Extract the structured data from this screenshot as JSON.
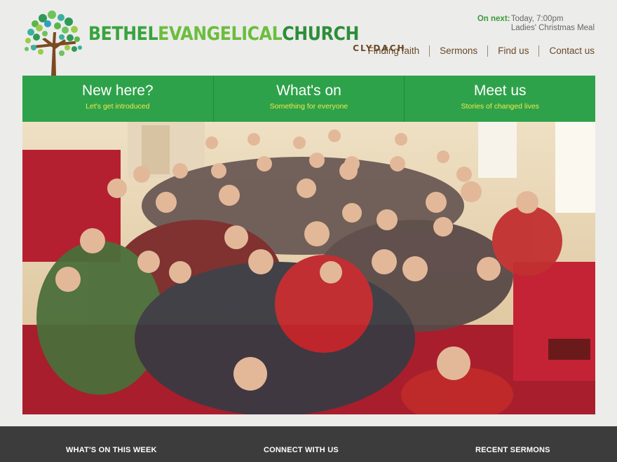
{
  "brand": {
    "name_part1": "BETHEL",
    "name_part2": "EVANGELICAL",
    "name_part3": "CHURCH",
    "location": "CLYDACH"
  },
  "on_next": {
    "label": "On next:",
    "line1": "Today, 7:00pm",
    "line2": "Ladies' Christmas Meal"
  },
  "nav": {
    "items": [
      {
        "label": "Finding faith"
      },
      {
        "label": "Sermons"
      },
      {
        "label": "Find us"
      },
      {
        "label": "Contact us"
      }
    ]
  },
  "promo": [
    {
      "title": "New here?",
      "subtitle": "Let's get introduced"
    },
    {
      "title": "What's on",
      "subtitle": "Something for everyone"
    },
    {
      "title": "Meet us",
      "subtitle": "Stories of changed lives"
    }
  ],
  "footer": {
    "col1": "WHAT'S ON THIS WEEK",
    "col2": "CONNECT WITH US",
    "col3": "RECENT SERMONS"
  },
  "colors": {
    "brand_green": "#2ea24a",
    "accent_yellow": "#f2e94a",
    "nav_brown": "#6a4a28",
    "footer_bg": "#3c3c3c"
  }
}
